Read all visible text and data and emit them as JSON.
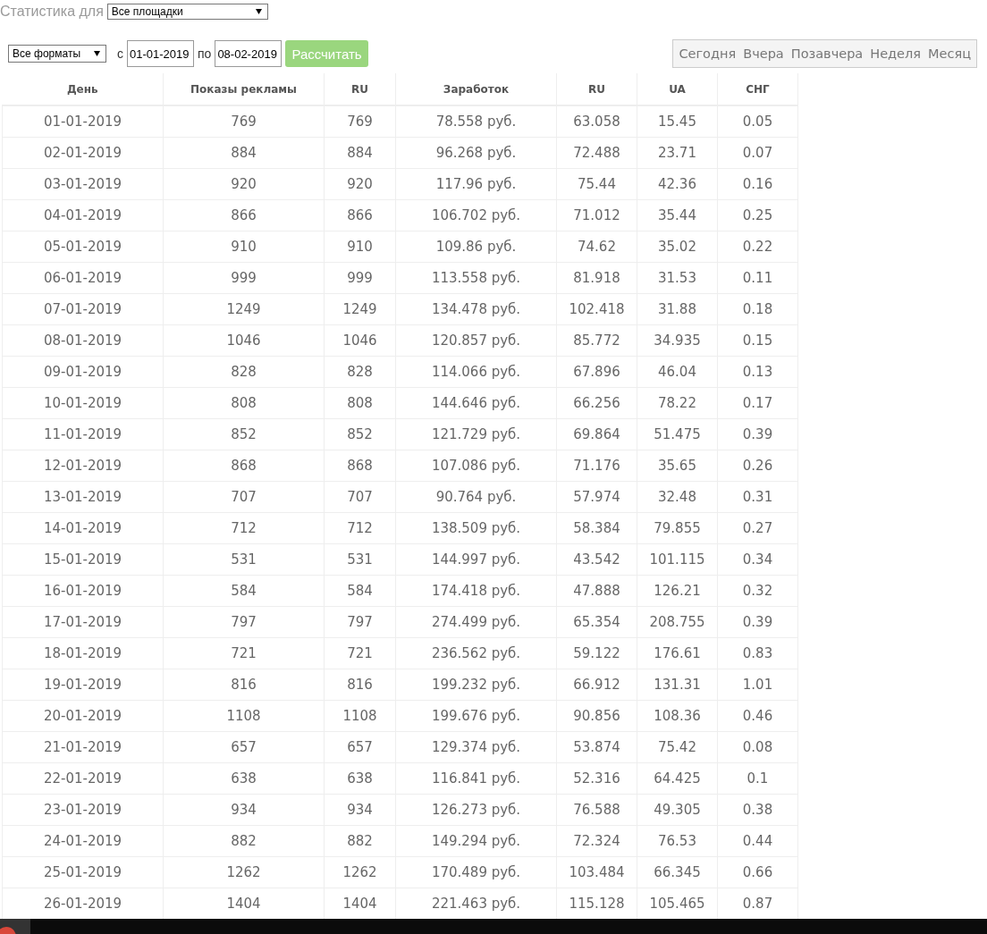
{
  "filter": {
    "label": "Статистика для",
    "site_select": "Все площадки"
  },
  "controls": {
    "format_select": "Все форматы",
    "from_label": "с",
    "from_date": "01-01-2019",
    "to_label": "по",
    "to_date": "08-02-2019",
    "calculate_button": "Рассчитать"
  },
  "periods": [
    "Сегодня",
    "Вчера",
    "Позавчера",
    "Неделя",
    "Месяц"
  ],
  "table": {
    "columns": [
      "День",
      "Показы рекламы",
      "RU",
      "Заработок",
      "RU",
      "UA",
      "СНГ"
    ],
    "rows": [
      [
        "01-01-2019",
        "769",
        "769",
        "78.558 руб.",
        "63.058",
        "15.45",
        "0.05"
      ],
      [
        "02-01-2019",
        "884",
        "884",
        "96.268 руб.",
        "72.488",
        "23.71",
        "0.07"
      ],
      [
        "03-01-2019",
        "920",
        "920",
        "117.96 руб.",
        "75.44",
        "42.36",
        "0.16"
      ],
      [
        "04-01-2019",
        "866",
        "866",
        "106.702 руб.",
        "71.012",
        "35.44",
        "0.25"
      ],
      [
        "05-01-2019",
        "910",
        "910",
        "109.86 руб.",
        "74.62",
        "35.02",
        "0.22"
      ],
      [
        "06-01-2019",
        "999",
        "999",
        "113.558 руб.",
        "81.918",
        "31.53",
        "0.11"
      ],
      [
        "07-01-2019",
        "1249",
        "1249",
        "134.478 руб.",
        "102.418",
        "31.88",
        "0.18"
      ],
      [
        "08-01-2019",
        "1046",
        "1046",
        "120.857 руб.",
        "85.772",
        "34.935",
        "0.15"
      ],
      [
        "09-01-2019",
        "828",
        "828",
        "114.066 руб.",
        "67.896",
        "46.04",
        "0.13"
      ],
      [
        "10-01-2019",
        "808",
        "808",
        "144.646 руб.",
        "66.256",
        "78.22",
        "0.17"
      ],
      [
        "11-01-2019",
        "852",
        "852",
        "121.729 руб.",
        "69.864",
        "51.475",
        "0.39"
      ],
      [
        "12-01-2019",
        "868",
        "868",
        "107.086 руб.",
        "71.176",
        "35.65",
        "0.26"
      ],
      [
        "13-01-2019",
        "707",
        "707",
        "90.764 руб.",
        "57.974",
        "32.48",
        "0.31"
      ],
      [
        "14-01-2019",
        "712",
        "712",
        "138.509 руб.",
        "58.384",
        "79.855",
        "0.27"
      ],
      [
        "15-01-2019",
        "531",
        "531",
        "144.997 руб.",
        "43.542",
        "101.115",
        "0.34"
      ],
      [
        "16-01-2019",
        "584",
        "584",
        "174.418 руб.",
        "47.888",
        "126.21",
        "0.32"
      ],
      [
        "17-01-2019",
        "797",
        "797",
        "274.499 руб.",
        "65.354",
        "208.755",
        "0.39"
      ],
      [
        "18-01-2019",
        "721",
        "721",
        "236.562 руб.",
        "59.122",
        "176.61",
        "0.83"
      ],
      [
        "19-01-2019",
        "816",
        "816",
        "199.232 руб.",
        "66.912",
        "131.31",
        "1.01"
      ],
      [
        "20-01-2019",
        "1108",
        "1108",
        "199.676 руб.",
        "90.856",
        "108.36",
        "0.46"
      ],
      [
        "21-01-2019",
        "657",
        "657",
        "129.374 руб.",
        "53.874",
        "75.42",
        "0.08"
      ],
      [
        "22-01-2019",
        "638",
        "638",
        "116.841 руб.",
        "52.316",
        "64.425",
        "0.1"
      ],
      [
        "23-01-2019",
        "934",
        "934",
        "126.273 руб.",
        "76.588",
        "49.305",
        "0.38"
      ],
      [
        "24-01-2019",
        "882",
        "882",
        "149.294 руб.",
        "72.324",
        "76.53",
        "0.44"
      ],
      [
        "25-01-2019",
        "1262",
        "1262",
        "170.489 руб.",
        "103.484",
        "66.345",
        "0.66"
      ],
      [
        "26-01-2019",
        "1404",
        "1404",
        "221.463 руб.",
        "115.128",
        "105.465",
        "0.87"
      ]
    ]
  }
}
